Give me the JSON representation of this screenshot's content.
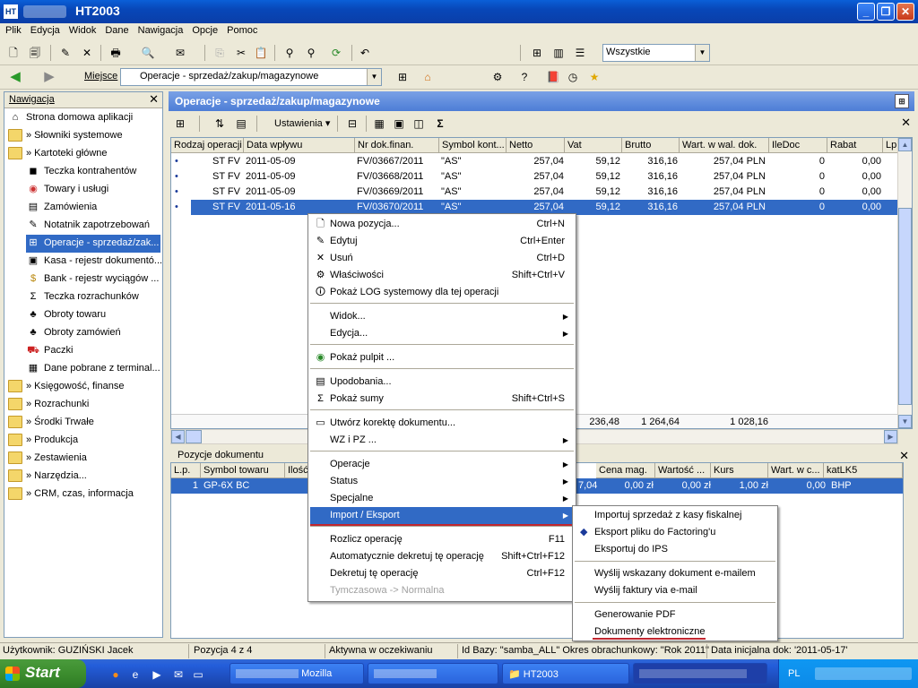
{
  "window": {
    "app_icon": "HT",
    "title": "HT2003"
  },
  "menu": [
    "Plik",
    "Edycja",
    "Widok",
    "Dane",
    "Nawigacja",
    "Opcje",
    "Pomoc"
  ],
  "toolbar1": {
    "filter_value": "Wszystkie"
  },
  "toolbar2": {
    "location_label": "Miejsce",
    "location_value": "Operacje - sprzedaż/zakup/magazynowe"
  },
  "nav": {
    "title": "Nawigacja",
    "items": [
      {
        "label": "Strona domowa aplikacji",
        "icon": "home-icon"
      },
      {
        "label": "» Słowniki systemowe",
        "icon": "folder-icon"
      },
      {
        "label": "» Kartoteki główne",
        "icon": "folder-open-icon"
      },
      {
        "label": "Teczka kontrahentów",
        "icon": "contacts-icon"
      },
      {
        "label": "Towary i usługi",
        "icon": "goods-icon"
      },
      {
        "label": "Zamówienia",
        "icon": "orders-icon"
      },
      {
        "label": "Notatnik zapotrzebowań",
        "icon": "notebook-icon"
      },
      {
        "label": "Operacje - sprzedaż/zak...",
        "icon": "operations-icon"
      },
      {
        "label": "Kasa - rejestr dokumentó...",
        "icon": "cash-icon"
      },
      {
        "label": "Bank - rejestr wyciągów ...",
        "icon": "bank-icon"
      },
      {
        "label": "Teczka rozrachunków",
        "icon": "sigma-icon"
      },
      {
        "label": "Obroty towaru",
        "icon": "turnover-icon"
      },
      {
        "label": "Obroty zamówień",
        "icon": "order-turnover-icon"
      },
      {
        "label": "Paczki",
        "icon": "truck-icon"
      },
      {
        "label": "Dane pobrane z terminal...",
        "icon": "terminal-icon"
      },
      {
        "label": "» Księgowość, finanse",
        "icon": "folder-icon"
      },
      {
        "label": "» Rozrachunki",
        "icon": "folder-icon"
      },
      {
        "label": "» Środki Trwałe",
        "icon": "folder-icon"
      },
      {
        "label": "» Produkcja",
        "icon": "folder-icon"
      },
      {
        "label": "» Zestawienia",
        "icon": "folder-icon"
      },
      {
        "label": "» Narzędzia...",
        "icon": "folder-icon"
      },
      {
        "label": "» CRM, czas, informacja",
        "icon": "folder-icon"
      }
    ]
  },
  "main": {
    "title": "Operacje - sprzedaż/zakup/magazynowe",
    "settings_label": "Ustawienia",
    "columns": [
      "Rodzaj operacji",
      "Data wpływu",
      "Nr dok.finan.",
      "Symbol kont...",
      "Netto",
      "Vat",
      "Brutto",
      "Wart. w wal. dok.",
      "IleDoc",
      "Rabat",
      "Lp"
    ],
    "rows": [
      {
        "type": "ST FV",
        "date": "2011-05-09",
        "doc": "FV/03667/2011",
        "symbol": "\"AS\"",
        "netto": "257,04",
        "vat": "59,12",
        "brutto": "316,16",
        "wal": "257,04 PLN",
        "ile": "0",
        "rabat": "0,00"
      },
      {
        "type": "ST FV",
        "date": "2011-05-09",
        "doc": "FV/03668/2011",
        "symbol": "\"AS\"",
        "netto": "257,04",
        "vat": "59,12",
        "brutto": "316,16",
        "wal": "257,04 PLN",
        "ile": "0",
        "rabat": "0,00"
      },
      {
        "type": "ST FV",
        "date": "2011-05-09",
        "doc": "FV/03669/2011",
        "symbol": "\"AS\"",
        "netto": "257,04",
        "vat": "59,12",
        "brutto": "316,16",
        "wal": "257,04 PLN",
        "ile": "0",
        "rabat": "0,00"
      },
      {
        "type": "ST FV",
        "date": "2011-05-16",
        "doc": "FV/03670/2011",
        "symbol": "\"AS\"",
        "netto": "257,04",
        "vat": "59,12",
        "brutto": "316,16",
        "wal": "257,04 PLN",
        "ile": "0",
        "rabat": "0,00"
      }
    ],
    "totals": {
      "vat": "236,48",
      "brutto": "1 264,64",
      "wal": "1 028,16"
    }
  },
  "positions": {
    "title": "Pozycje dokumentu",
    "columns": [
      "L.p.",
      "Symbol towaru",
      "Ilość",
      "Cena mag.",
      "Wartość ...",
      "Kurs",
      "Wart. w c...",
      "katLK5"
    ],
    "row": {
      "lp": "1",
      "symbol": "GP-6X BC",
      "partial": "7,04",
      "cena": "0,00 zł",
      "wartosc": "0,00 zł",
      "kurs": "1,00 zł",
      "wartc": "0,00",
      "kat": "BHP"
    }
  },
  "context_menu": [
    {
      "label": "Nowa pozycja...",
      "shortcut": "Ctrl+N",
      "icon": "new-doc-icon"
    },
    {
      "label": "Edytuj",
      "shortcut": "Ctrl+Enter",
      "icon": "edit-icon"
    },
    {
      "label": "Usuń",
      "shortcut": "Ctrl+D",
      "icon": "delete-icon"
    },
    {
      "label": "Właściwości",
      "shortcut": "Shift+Ctrl+V",
      "icon": "properties-icon"
    },
    {
      "label": "Pokaż LOG systemowy dla tej operacji",
      "shortcut": "",
      "icon": "log-icon"
    },
    {
      "label": "Widok...",
      "shortcut": "",
      "icon": ""
    },
    {
      "label": "Edycja...",
      "shortcut": "",
      "icon": ""
    },
    {
      "label": "Pokaż pulpit ...",
      "shortcut": "",
      "icon": "desktop-icon"
    },
    {
      "label": "Upodobania...",
      "shortcut": "",
      "icon": "favorites-icon"
    },
    {
      "label": "Pokaż sumy",
      "shortcut": "Shift+Ctrl+S",
      "icon": "sigma-icon"
    },
    {
      "label": "Utwórz korektę dokumentu...",
      "shortcut": "",
      "icon": "correction-icon"
    },
    {
      "label": "WZ i PZ ...",
      "shortcut": "",
      "icon": ""
    },
    {
      "label": "Operacje",
      "shortcut": "",
      "icon": ""
    },
    {
      "label": "Status",
      "shortcut": "",
      "icon": ""
    },
    {
      "label": "Specjalne",
      "shortcut": "",
      "icon": ""
    },
    {
      "label": "Import / Eksport",
      "shortcut": "",
      "icon": ""
    },
    {
      "label": "Rozlicz operację",
      "shortcut": "F11",
      "icon": ""
    },
    {
      "label": "Automatycznie dekretuj tę operację",
      "shortcut": "Shift+Ctrl+F12",
      "icon": ""
    },
    {
      "label": "Dekretuj tę operację",
      "shortcut": "Ctrl+F12",
      "icon": ""
    },
    {
      "label": "Tymczasowa -> Normalna",
      "shortcut": "",
      "icon": ""
    }
  ],
  "submenu": [
    {
      "label": "Importuj sprzedaż z kasy fiskalnej"
    },
    {
      "label": "Eksport pliku do Factoring'u"
    },
    {
      "label": "Eksportuj do IPS"
    },
    {
      "label": "Wyślij wskazany dokument e-mailem"
    },
    {
      "label": "Wyślij faktury via e-mail"
    },
    {
      "label": "Generowanie PDF"
    },
    {
      "label": "Dokumenty elektroniczne"
    }
  ],
  "status": {
    "user": "Użytkownik: GUZIŃSKI Jacek",
    "position": "Pozycja 4 z 4",
    "state": "Aktywna w oczekiwaniu",
    "db": "Id Bazy: \"samba_ALL\" Okres obrachunkowy: \"Rok 2011\"",
    "date": "Data inicjalna dok: '2011-05-17'"
  },
  "taskbar": {
    "start": "Start",
    "tasks": [
      {
        "label": "Mozilla"
      },
      {
        "label": "HT2003"
      },
      {
        "label": "HT2003"
      }
    ],
    "tray_lang": "PL"
  },
  "colors": {
    "accent": "#316ac5",
    "underline": "#c0262f"
  }
}
